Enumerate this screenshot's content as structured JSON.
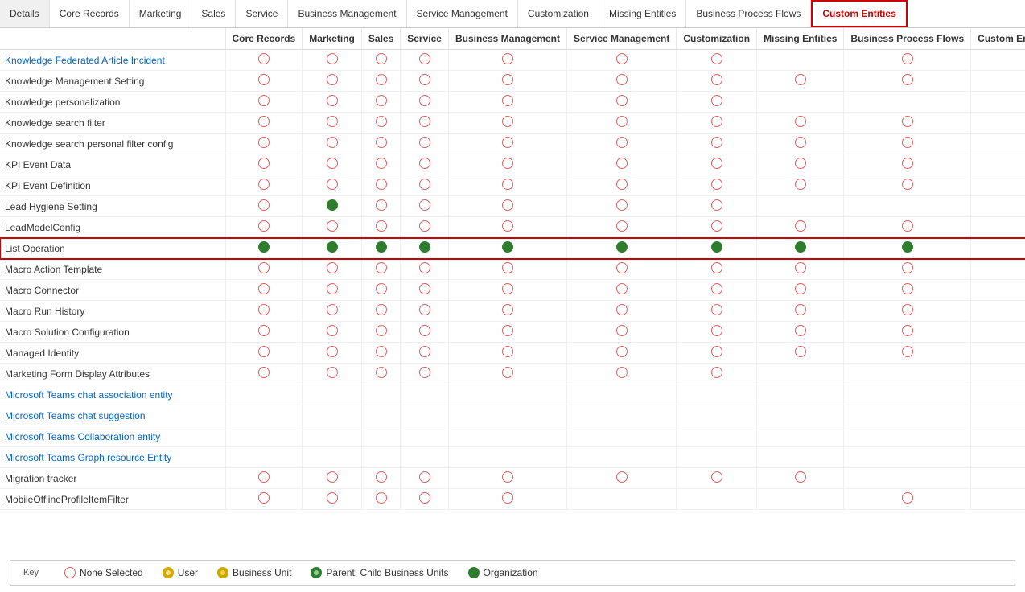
{
  "tabs": [
    {
      "label": "Details",
      "active": false
    },
    {
      "label": "Core Records",
      "active": false
    },
    {
      "label": "Marketing",
      "active": false
    },
    {
      "label": "Sales",
      "active": false
    },
    {
      "label": "Service",
      "active": false
    },
    {
      "label": "Business Management",
      "active": false
    },
    {
      "label": "Service Management",
      "active": false
    },
    {
      "label": "Customization",
      "active": false
    },
    {
      "label": "Missing Entities",
      "active": false
    },
    {
      "label": "Business Process Flows",
      "active": false
    },
    {
      "label": "Custom Entities",
      "active": true
    }
  ],
  "columns": [
    "",
    "Core Records",
    "Marketing",
    "Sales",
    "Service",
    "Business Management",
    "Service Management",
    "Customization",
    "Missing Entities",
    "Business Process Flows",
    "Custom Entities"
  ],
  "rows": [
    {
      "name": "Knowledge Federated Article Incident",
      "blue": true,
      "values": [
        "none",
        "none",
        "none",
        "none",
        "none",
        "none",
        "none",
        "",
        "none"
      ]
    },
    {
      "name": "Knowledge Management Setting",
      "blue": false,
      "values": [
        "none",
        "none",
        "none",
        "none",
        "none",
        "none",
        "none",
        "none",
        "none"
      ]
    },
    {
      "name": "Knowledge personalization",
      "blue": false,
      "values": [
        "none",
        "none",
        "none",
        "none",
        "none",
        "none",
        "none",
        "",
        ""
      ]
    },
    {
      "name": "Knowledge search filter",
      "blue": false,
      "values": [
        "none",
        "none",
        "none",
        "none",
        "none",
        "none",
        "none",
        "none",
        "none"
      ]
    },
    {
      "name": "Knowledge search personal filter config",
      "blue": false,
      "values": [
        "none",
        "none",
        "none",
        "none",
        "none",
        "none",
        "none",
        "none",
        "none"
      ]
    },
    {
      "name": "KPI Event Data",
      "blue": false,
      "values": [
        "none",
        "none",
        "none",
        "none",
        "none",
        "none",
        "none",
        "none",
        "none"
      ]
    },
    {
      "name": "KPI Event Definition",
      "blue": false,
      "values": [
        "none",
        "none",
        "none",
        "none",
        "none",
        "none",
        "none",
        "none",
        "none"
      ]
    },
    {
      "name": "Lead Hygiene Setting",
      "blue": false,
      "values": [
        "none",
        "org",
        "none",
        "none",
        "none",
        "none",
        "none",
        "",
        ""
      ]
    },
    {
      "name": "LeadModelConfig",
      "blue": false,
      "values": [
        "none",
        "none",
        "none",
        "none",
        "none",
        "none",
        "none",
        "none",
        "none"
      ]
    },
    {
      "name": "List Operation",
      "blue": false,
      "highlighted": true,
      "values": [
        "org",
        "org",
        "org",
        "org",
        "org",
        "org",
        "org",
        "org",
        "org"
      ]
    },
    {
      "name": "Macro Action Template",
      "blue": false,
      "values": [
        "none",
        "none",
        "none",
        "none",
        "none",
        "none",
        "none",
        "none",
        "none"
      ]
    },
    {
      "name": "Macro Connector",
      "blue": false,
      "values": [
        "none",
        "none",
        "none",
        "none",
        "none",
        "none",
        "none",
        "none",
        "none"
      ]
    },
    {
      "name": "Macro Run History",
      "blue": false,
      "values": [
        "none",
        "none",
        "none",
        "none",
        "none",
        "none",
        "none",
        "none",
        "none"
      ]
    },
    {
      "name": "Macro Solution Configuration",
      "blue": false,
      "values": [
        "none",
        "none",
        "none",
        "none",
        "none",
        "none",
        "none",
        "none",
        "none"
      ]
    },
    {
      "name": "Managed Identity",
      "blue": false,
      "values": [
        "none",
        "none",
        "none",
        "none",
        "none",
        "none",
        "none",
        "none",
        "none"
      ]
    },
    {
      "name": "Marketing Form Display Attributes",
      "blue": false,
      "values": [
        "none",
        "none",
        "none",
        "none",
        "none",
        "none",
        "none",
        "",
        ""
      ]
    },
    {
      "name": "Microsoft Teams chat association entity",
      "blue": true,
      "values": [
        "",
        "",
        "",
        "",
        "",
        "",
        "",
        "",
        ""
      ]
    },
    {
      "name": "Microsoft Teams chat suggestion",
      "blue": true,
      "values": [
        "",
        "",
        "",
        "",
        "",
        "",
        "",
        "",
        ""
      ]
    },
    {
      "name": "Microsoft Teams Collaboration entity",
      "blue": true,
      "values": [
        "",
        "",
        "",
        "",
        "",
        "",
        "",
        "",
        ""
      ]
    },
    {
      "name": "Microsoft Teams Graph resource Entity",
      "blue": true,
      "values": [
        "",
        "",
        "",
        "",
        "",
        "",
        "",
        "",
        ""
      ]
    },
    {
      "name": "Migration tracker",
      "blue": false,
      "values": [
        "none",
        "none",
        "none",
        "none",
        "none",
        "none",
        "none",
        "none",
        ""
      ]
    },
    {
      "name": "MobileOfflineProfileItemFilter",
      "blue": false,
      "values": [
        "none",
        "none",
        "none",
        "none",
        "none",
        "",
        "",
        "",
        "none"
      ]
    }
  ],
  "key": {
    "title": "Key",
    "items": [
      {
        "type": "none",
        "label": "None Selected"
      },
      {
        "type": "user",
        "label": "User"
      },
      {
        "type": "bu",
        "label": "Business Unit"
      },
      {
        "type": "parent",
        "label": "Parent: Child Business Units"
      },
      {
        "type": "org",
        "label": "Organization"
      }
    ]
  }
}
